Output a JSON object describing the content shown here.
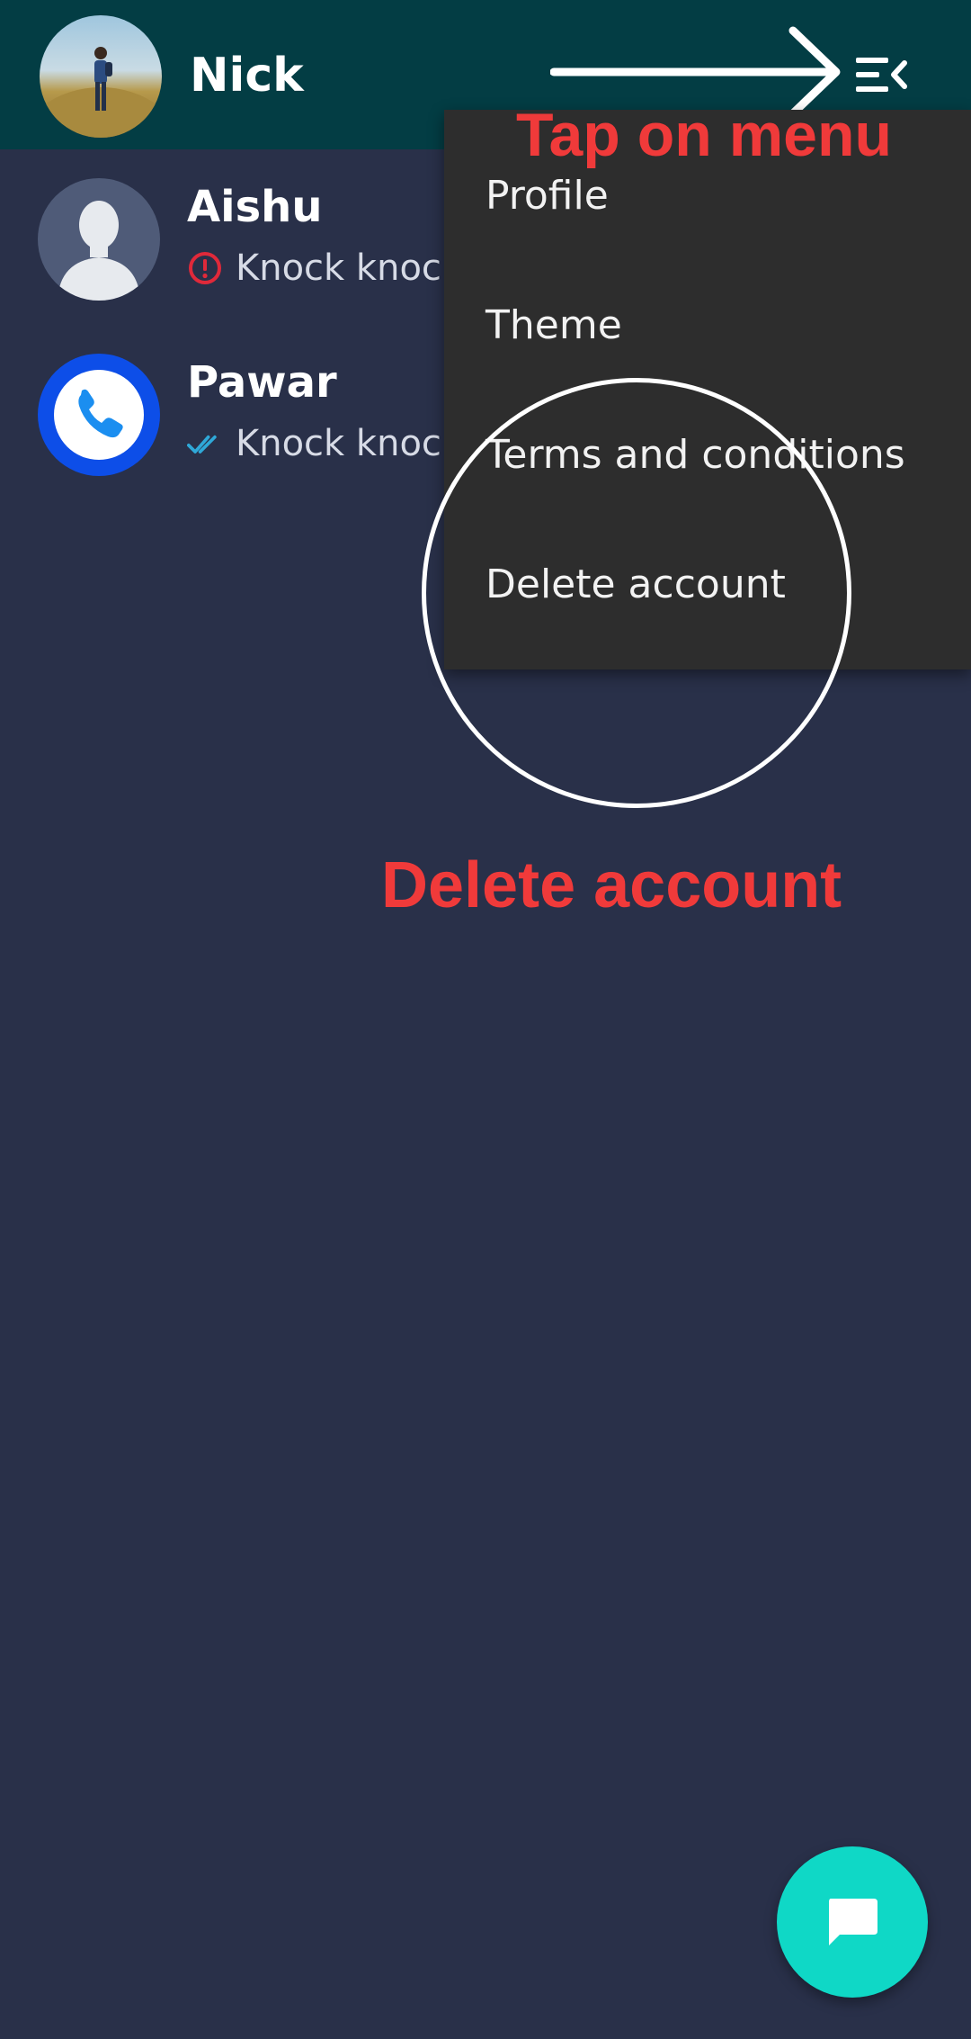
{
  "header": {
    "user_name": "Nick",
    "avatar_icon": "profile-photo",
    "menu_icon": "menu-collapse-icon",
    "background": "#033d44"
  },
  "chats": [
    {
      "name": "Aishu",
      "preview": "Knock knock",
      "status_icon": "error-circle-icon",
      "status_color": "#e0293a",
      "avatar": "default-silhouette"
    },
    {
      "name": "Pawar",
      "preview": "Knock knock",
      "status_icon": "double-check-icon",
      "status_color": "#2fa8d8",
      "avatar": "phone-icon"
    }
  ],
  "menu": {
    "items": [
      "Profile",
      "Theme",
      "Terms and conditions",
      "Delete account"
    ],
    "background": "#2d2d2d"
  },
  "annotations": {
    "tap_label": "Tap on menu",
    "delete_label": "Delete account",
    "color": "#f03a3a"
  },
  "fab": {
    "icon": "chat-bubble-icon",
    "color": "#0fd8c6"
  },
  "colors": {
    "background": "#293049"
  }
}
